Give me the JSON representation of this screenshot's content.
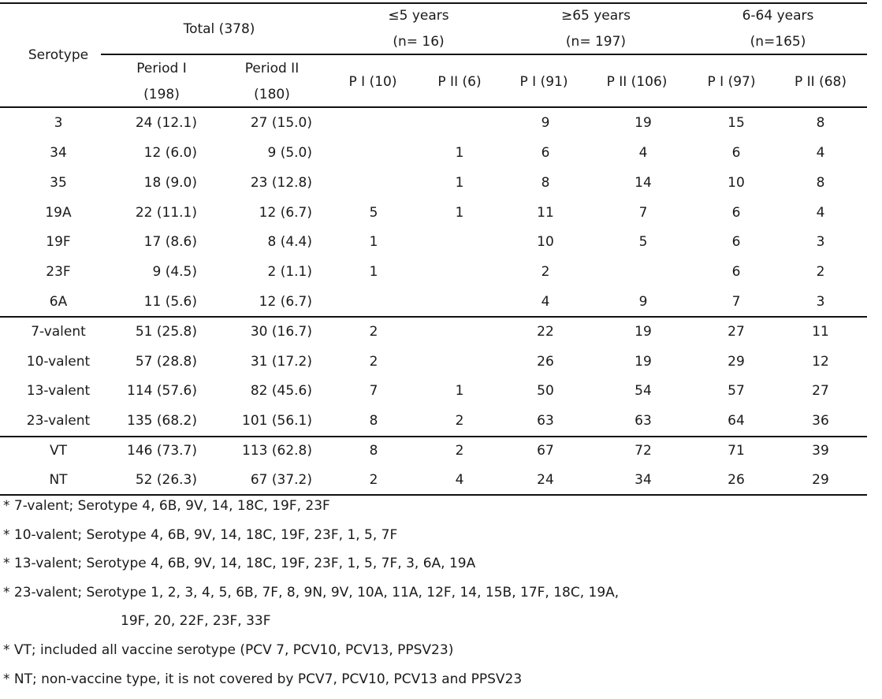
{
  "table": {
    "row_header": "Serotype",
    "groups": [
      {
        "line1": "Total (378)",
        "line2": ""
      },
      {
        "line1": "≤5 years",
        "line2": "(n= 16)"
      },
      {
        "line1": "≥65 years",
        "line2": "(n= 197)"
      },
      {
        "line1": "6-64 years",
        "line2": "(n=165)"
      }
    ],
    "subheaders": [
      {
        "line1": "Period I",
        "line2": "(198)"
      },
      {
        "line1": "Period II",
        "line2": "(180)"
      },
      {
        "line1": "P I (10)",
        "line2": ""
      },
      {
        "line1": "P II (6)",
        "line2": ""
      },
      {
        "line1": "P I (91)",
        "line2": ""
      },
      {
        "line1": "P II (106)",
        "line2": ""
      },
      {
        "line1": "P I (97)",
        "line2": ""
      },
      {
        "line1": "P II (68)",
        "line2": ""
      }
    ],
    "rows": [
      {
        "label": "3",
        "cells": [
          "24 (12.1)",
          "27 (15.0)",
          "",
          "",
          "9",
          "19",
          "15",
          "8"
        ]
      },
      {
        "label": "34",
        "cells": [
          "12 (6.0)",
          "9 (5.0)",
          "",
          "1",
          "6",
          "4",
          "6",
          "4"
        ]
      },
      {
        "label": "35",
        "cells": [
          "18 (9.0)",
          "23 (12.8)",
          "",
          "1",
          "8",
          "14",
          "10",
          "8"
        ]
      },
      {
        "label": "19A",
        "cells": [
          "22 (11.1)",
          "12 (6.7)",
          "5",
          "1",
          "11",
          "7",
          "6",
          "4"
        ]
      },
      {
        "label": "19F",
        "cells": [
          "17 (8.6)",
          "8 (4.4)",
          "1",
          "",
          "10",
          "5",
          "6",
          "3"
        ]
      },
      {
        "label": "23F",
        "cells": [
          "9 (4.5)",
          "2 (1.1)",
          "1",
          "",
          "2",
          "",
          "6",
          "2"
        ]
      },
      {
        "label": "6A",
        "cells": [
          "11 (5.6)",
          "12 (6.7)",
          "",
          "",
          "4",
          "9",
          "7",
          "3"
        ]
      },
      {
        "label": "7-valent",
        "cells": [
          "51 (25.8)",
          "30 (16.7)",
          "2",
          "",
          "22",
          "19",
          "27",
          "11"
        ]
      },
      {
        "label": "10-valent",
        "cells": [
          "57 (28.8)",
          "31 (17.2)",
          "2",
          "",
          "26",
          "19",
          "29",
          "12"
        ]
      },
      {
        "label": "13-valent",
        "cells": [
          "114 (57.6)",
          "82 (45.6)",
          "7",
          "1",
          "50",
          "54",
          "57",
          "27"
        ]
      },
      {
        "label": "23-valent",
        "cells": [
          "135 (68.2)",
          "101 (56.1)",
          "8",
          "2",
          "63",
          "63",
          "64",
          "36"
        ]
      },
      {
        "label": "VT",
        "cells": [
          "146 (73.7)",
          "113 (62.8)",
          "8",
          "2",
          "67",
          "72",
          "71",
          "39"
        ]
      },
      {
        "label": "NT",
        "cells": [
          "52 (26.3)",
          "67 (37.2)",
          "2",
          "4",
          "24",
          "34",
          "26",
          "29"
        ]
      }
    ]
  },
  "footnotes": [
    "* 7-valent; Serotype 4, 6B, 9V, 14, 18C, 19F, 23F",
    "* 10-valent; Serotype 4, 6B, 9V, 14, 18C, 19F, 23F, 1, 5, 7F",
    "* 13-valent; Serotype 4, 6B, 9V, 14, 18C, 19F, 23F, 1, 5, 7F, 3, 6A, 19A",
    "* 23-valent; Serotype 1, 2, 3, 4, 5, 6B, 7F, 8, 9N, 9V, 10A, 11A, 12F, 14, 15B, 17F, 18C, 19A,",
    "19F, 20, 22F, 23F, 33F",
    "* VT; included all vaccine serotype (PCV 7, PCV10, PCV13, PPSV23)",
    "* NT; non-vaccine type, it is not covered by PCV7, PCV10, PCV13 and PPSV23"
  ]
}
